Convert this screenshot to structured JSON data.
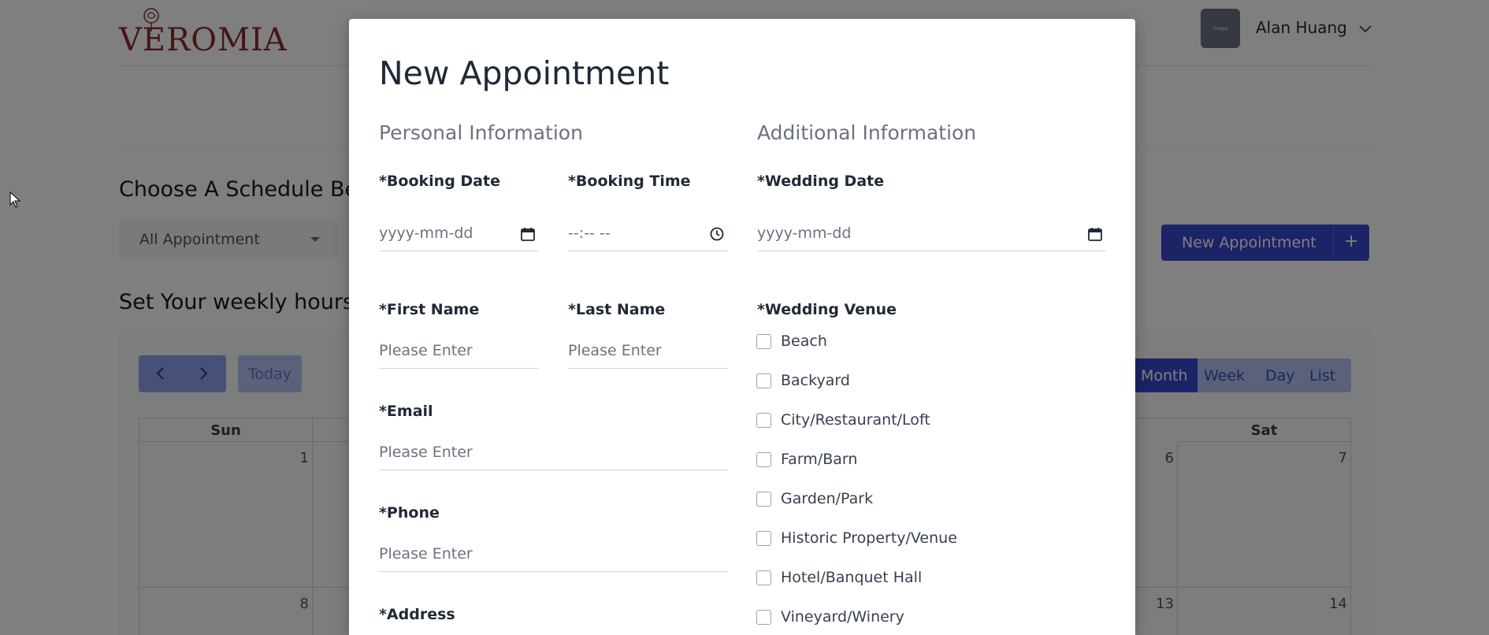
{
  "app": {
    "logo_text": "VEROMIA",
    "user": {
      "name": "Alan Huang",
      "avatar_text": "image"
    }
  },
  "background": {
    "heading_schedule": "Choose A Schedule Be",
    "select_value": "All Appointment",
    "new_appointment_label": "New Appointment",
    "new_appointment_plus": "+",
    "heading_weekly": "Set Your weekly hours",
    "calendar": {
      "today_label": "Today",
      "prev_icon": "chevron-left-icon",
      "next_icon": "chevron-right-icon",
      "views": [
        "Month",
        "Week",
        "Day",
        "List"
      ],
      "active_view": "Month",
      "weekday_headers": [
        "Sun",
        "",
        "",
        "",
        "",
        "",
        "Sat"
      ],
      "week1_days": [
        "1",
        "",
        "",
        "",
        "",
        "6",
        "7"
      ],
      "week2_days": [
        "8",
        "",
        "",
        "",
        "",
        "13",
        "14"
      ]
    }
  },
  "modal": {
    "title": "New Appointment",
    "personal_section": "Personal Information",
    "additional_section": "Additional Information",
    "booking_date": {
      "label": "*Booking Date",
      "placeholder": "yyyy-mm-dd",
      "icon": "calendar-icon"
    },
    "booking_time": {
      "label": "*Booking Time",
      "placeholder": "--:-- --",
      "icon": "clock-icon"
    },
    "wedding_date": {
      "label": "*Wedding Date",
      "placeholder": "yyyy-mm-dd",
      "icon": "calendar-icon"
    },
    "first_name": {
      "label": "*First Name",
      "placeholder": "Please Enter"
    },
    "last_name": {
      "label": "*Last Name",
      "placeholder": "Please Enter"
    },
    "email": {
      "label": "*Email",
      "placeholder": "Please Enter"
    },
    "phone": {
      "label": "*Phone",
      "placeholder": "Please Enter"
    },
    "address": {
      "label": "*Address"
    },
    "wedding_venue": {
      "label": "*Wedding Venue",
      "options": [
        "Beach",
        "Backyard",
        "City/Restaurant/Loft",
        "Farm/Barn",
        "Garden/Park",
        "Historic Property/Venue",
        "Hotel/Banquet Hall",
        "Vineyard/Winery"
      ]
    }
  },
  "colors": {
    "primary": "#3949d0",
    "logo": "#8b2a2a",
    "overlay": "rgba(0,0,0,0.5)"
  }
}
